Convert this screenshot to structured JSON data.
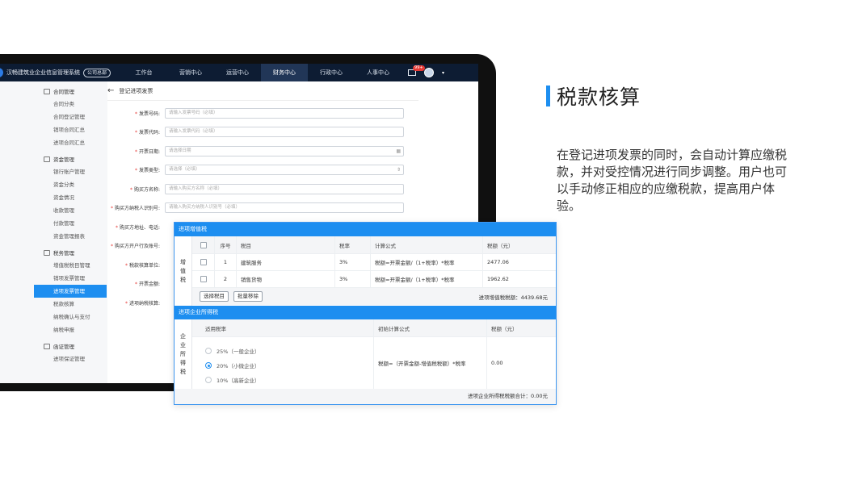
{
  "header": {
    "system_name": "汉畅建筑业企业信息管理系统",
    "org_tag": "公司总部",
    "nav": [
      "工作台",
      "营销中心",
      "运营中心",
      "财务中心",
      "行政中心",
      "人事中心"
    ],
    "active_nav": "财务中心",
    "mail_badge": "99+"
  },
  "sidebar": {
    "groups": [
      {
        "title": "合同管理",
        "icon": "contract-icon",
        "items": [
          "合同分类",
          "合同登记管理",
          "销项合同汇总",
          "进项合同汇总"
        ]
      },
      {
        "title": "资金管理",
        "icon": "funds-icon",
        "items": [
          "银行账户管理",
          "资金分类",
          "资金情况",
          "收款管理",
          "付款管理",
          "资金管理报表"
        ]
      },
      {
        "title": "税务管理",
        "icon": "tax-icon",
        "items": [
          "增值税税目管理",
          "销项发票管理",
          "进项发票管理",
          "税款核算",
          "纳税确认与支付",
          "纳税申报"
        ]
      },
      {
        "title": "函证管理",
        "icon": "confirmation-icon",
        "items": [
          "进项保证管理"
        ]
      }
    ],
    "active_item": "进项发票管理"
  },
  "form": {
    "back_label": "登记进项发票",
    "fields": [
      {
        "label": "发票号码:",
        "placeholder": "请输入发票号码（必填）",
        "required": true
      },
      {
        "label": "发票代码:",
        "placeholder": "请输入发票代码（必填）",
        "required": true
      },
      {
        "label": "开票日期:",
        "placeholder": "请选择日期",
        "required": true,
        "icon": "calendar-icon"
      },
      {
        "label": "发票类型:",
        "placeholder": "请选择（必填）",
        "required": true,
        "icon": "select-arrows-icon"
      },
      {
        "label": "购买方名称:",
        "placeholder": "请输入购买方名称（必填）",
        "required": true
      },
      {
        "label": "购买方纳税人识别号:",
        "placeholder": "请输入购买方纳税人识别号（必填）",
        "required": true
      },
      {
        "label": "购买方地址、电话:",
        "placeholder": "",
        "required": true
      },
      {
        "label": "购买方开户行及账号:",
        "placeholder": "",
        "required": true
      },
      {
        "label": "税款核算单位:",
        "placeholder": "",
        "required": true
      },
      {
        "label": "开票金额:",
        "placeholder": "",
        "required": true
      },
      {
        "label": "进项纳税核算:",
        "placeholder": "",
        "required": true
      }
    ]
  },
  "vat": {
    "title": "进项增值税",
    "side_label": "增值税",
    "columns": [
      "",
      "序号",
      "税目",
      "税率",
      "计算公式",
      "税额（元）"
    ],
    "rows": [
      {
        "no": "1",
        "item": "建筑服务",
        "rate": "3%",
        "formula": "税额=开票金额/（1+税率）*税率",
        "amount": "2477.06"
      },
      {
        "no": "2",
        "item": "销售货物",
        "rate": "3%",
        "formula": "税额=开票金额/（1+税率）*税率",
        "amount": "1962.62"
      }
    ],
    "btn_select": "选择税目",
    "btn_remove": "批量移除",
    "total": "进项增值税税额：4439.68元"
  },
  "cit": {
    "title": "进项企业所得税",
    "side_label": "企业所得税",
    "columns": [
      "适用税率",
      "初始计算公式",
      "税额（元）"
    ],
    "options": [
      {
        "label": "25%（一般企业）",
        "selected": false
      },
      {
        "label": "20%（小微企业）",
        "selected": true
      },
      {
        "label": "10%（高新企业）",
        "selected": false
      }
    ],
    "formula": "税额=（开票金额-增值税税额）*税率",
    "amount": "0.00",
    "total": "进项企业所得税税额合计：0.00元"
  },
  "intro": {
    "title": "税款核算",
    "description": "在登记进项发票的同时，会自动计算应缴税款，并对受控情况进行同步调整。用户也可以手动修正相应的应缴税款，提高用户体验。"
  },
  "colors": {
    "accent": "#1d8ef0",
    "nav_bg": "#0d1c33"
  }
}
